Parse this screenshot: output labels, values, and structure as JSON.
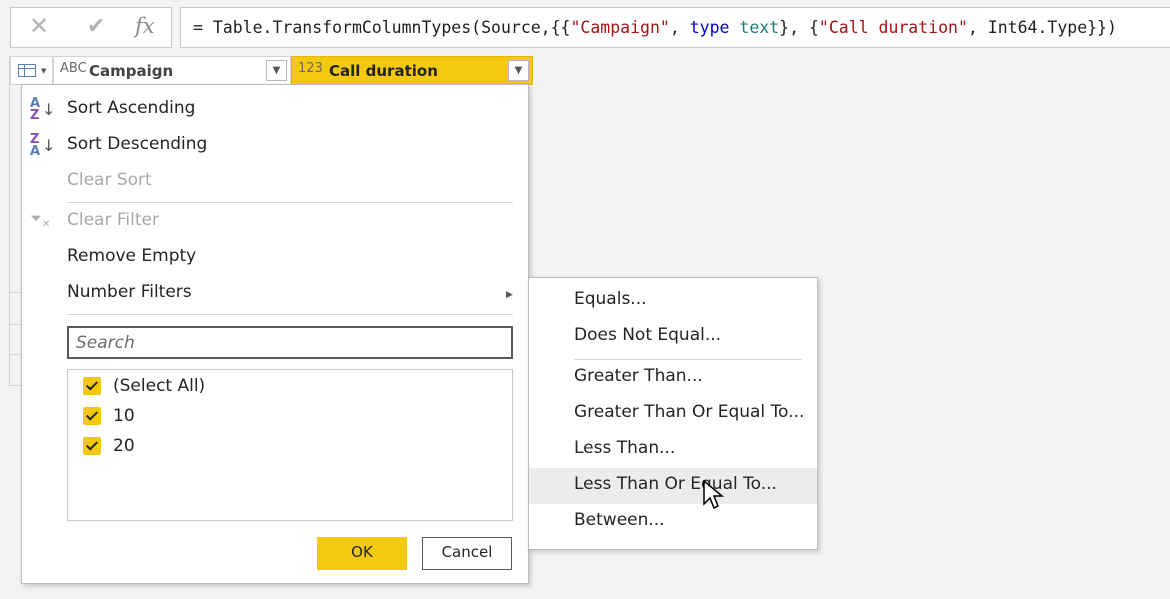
{
  "formula": {
    "prefix": "= Table.TransformColumnTypes(Source,{{",
    "s1": "\"Campaign\"",
    "mid1": ", ",
    "kw": "type",
    "sp": " ",
    "typ": "text",
    "mid2": "}, {",
    "s2": "\"Call duration\"",
    "suffix": ", Int64.Type}})"
  },
  "columns": [
    {
      "type_icon": "ABC",
      "name": "Campaign"
    },
    {
      "type_icon": "123",
      "name": "Call duration"
    }
  ],
  "menu": {
    "sort_asc": "Sort Ascending",
    "sort_desc": "Sort Descending",
    "clear_sort": "Clear Sort",
    "clear_filter": "Clear Filter",
    "remove_empty": "Remove Empty",
    "number_filters": "Number Filters"
  },
  "search": {
    "placeholder": "Search"
  },
  "values": [
    {
      "label": "(Select All)",
      "checked": true
    },
    {
      "label": "10",
      "checked": true
    },
    {
      "label": "20",
      "checked": true
    }
  ],
  "buttons": {
    "ok": "OK",
    "cancel": "Cancel"
  },
  "submenu": [
    "Equals...",
    "Does Not Equal...",
    "Greater Than...",
    "Greater Than Or Equal To...",
    "Less Than...",
    "Less Than Or Equal To...",
    "Between..."
  ],
  "colors": {
    "accent": "#f2c811"
  }
}
